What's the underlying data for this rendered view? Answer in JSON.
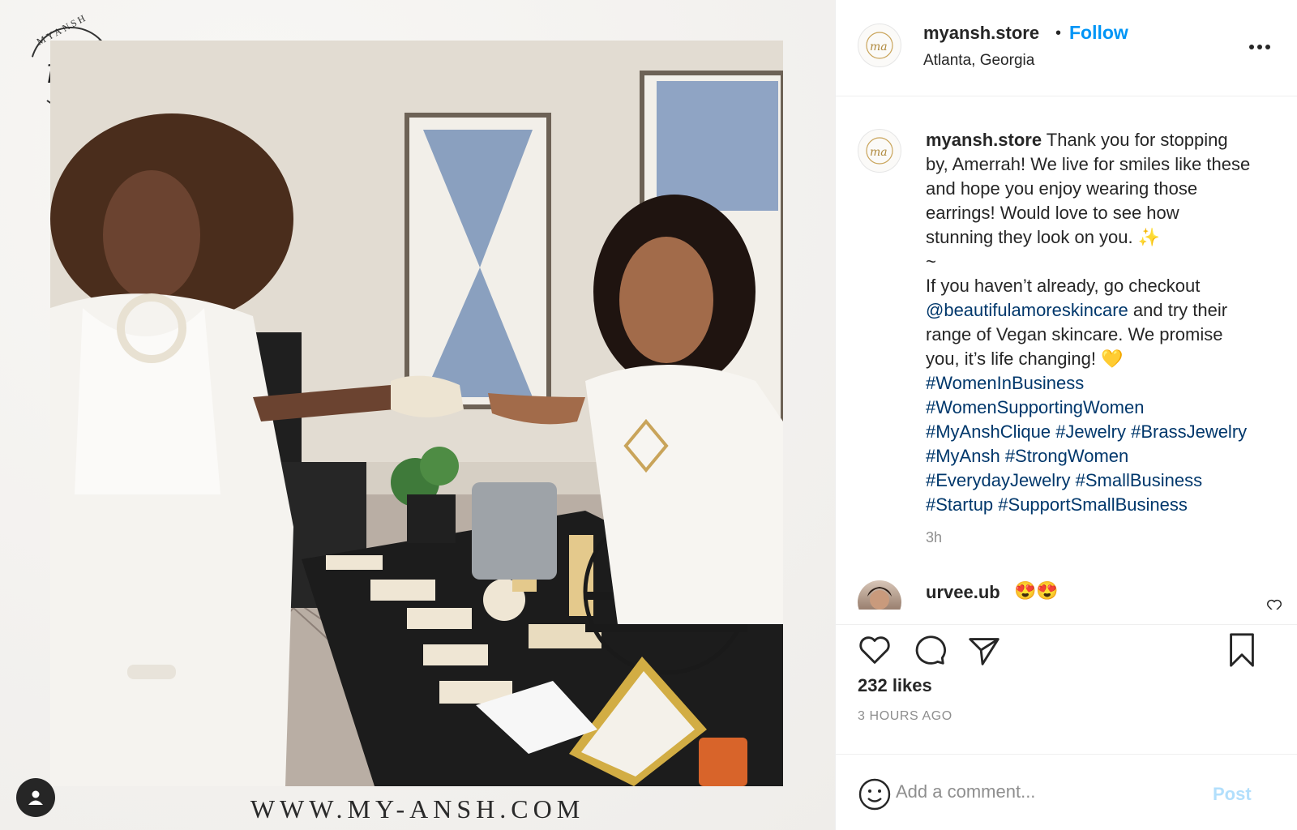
{
  "media": {
    "logo_brand": "MYANSH",
    "logo_monogram": "ma",
    "website": "WWW.MY-ANSH.COM",
    "tagged_icon": "person-icon"
  },
  "header": {
    "username": "myansh.store",
    "separator": "•",
    "follow_label": "Follow",
    "location": "Atlanta, Georgia",
    "more_icon": "ellipsis-icon"
  },
  "caption": {
    "username": "myansh.store",
    "lines": [
      "Thank you for stopping",
      "by, Amerrah! We live for smiles like these",
      "and hope you enjoy wearing those",
      "earrings! Would love to see how",
      "stunning they look on you. ✨",
      "~",
      "If you haven’t already, go checkout"
    ],
    "mention": "@beautifulamoreskincare",
    "after_mention": " and try their",
    "lines2": [
      "range of Vegan skincare. We promise",
      "you, it’s life changing! 💛"
    ],
    "hashtag_lines": [
      "#WomenInBusiness",
      "#WomenSupportingWomen",
      "#MyAnshClique #Jewelry #BrassJewelry",
      "#MyAnsh #StrongWomen",
      "#EverydayJewelry #SmallBusiness",
      "#Startup #SupportSmallBusiness"
    ],
    "time": "3h"
  },
  "comment": {
    "username": "urvee.ub",
    "text": "😍😍"
  },
  "actions": {
    "likes": "232 likes",
    "posted_ago": "3 HOURS AGO"
  },
  "add_comment": {
    "placeholder": "Add a comment...",
    "post_label": "Post"
  },
  "colors": {
    "follow": "#0095f6",
    "link": "#00376b",
    "muted": "#8e8e8e",
    "post_disabled": "#b2dffc"
  }
}
